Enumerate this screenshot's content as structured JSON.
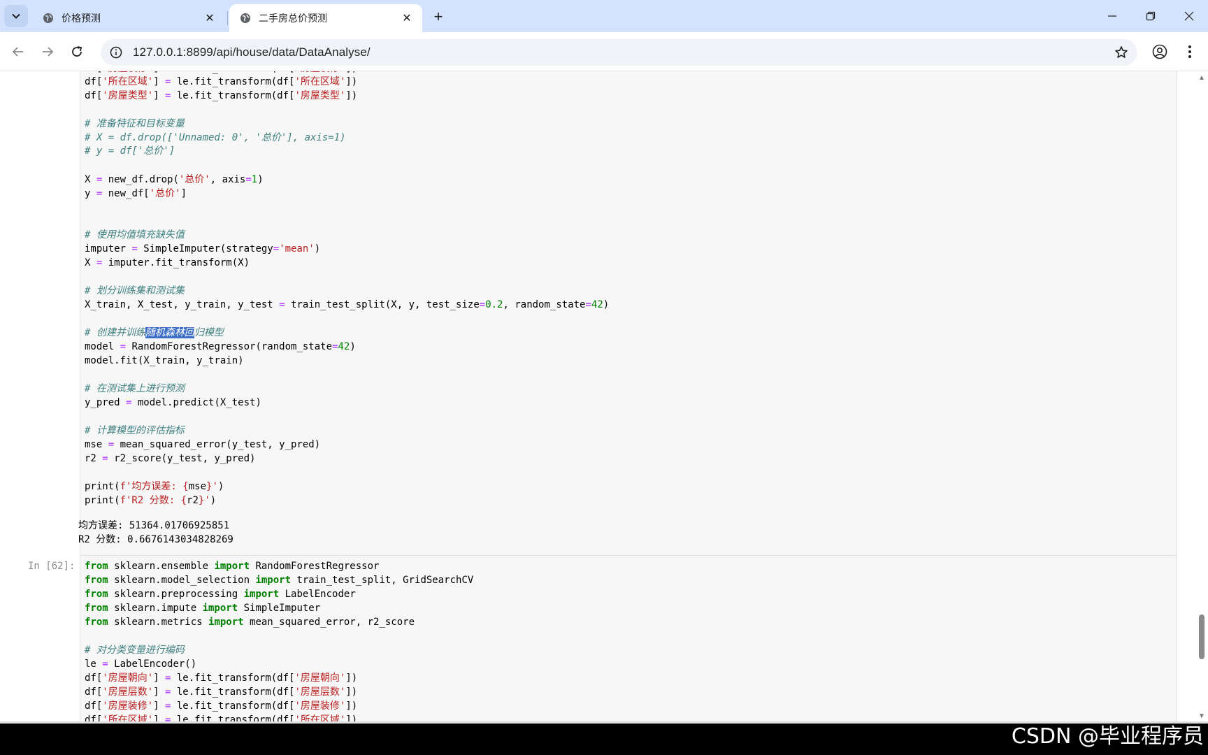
{
  "browser": {
    "tabs": [
      {
        "title": "价格预测",
        "active": false
      },
      {
        "title": "二手房总价预测",
        "active": true
      }
    ],
    "url": "127.0.0.1:8899/api/house/data/DataAnalyse/"
  },
  "cells": {
    "first": {
      "lines": [
        "df['所在区域'] = le.fit_transform(df['所在区域'])",
        "df['房屋类型'] = le.fit_transform(df['房屋类型'])",
        "",
        "# 准备特征和目标变量",
        "# X = df.drop(['Unnamed: 0', '总价'], axis=1)",
        "# y = df['总价']",
        "",
        "X = new_df.drop('总价', axis=1)",
        "y = new_df['总价']",
        "",
        "",
        "# 使用均值填充缺失值",
        "imputer = SimpleImputer(strategy='mean')",
        "X = imputer.fit_transform(X)",
        "",
        "# 划分训练集和测试集",
        "X_train, X_test, y_train, y_test = train_test_split(X, y, test_size=0.2, random_state=42)",
        "",
        "# 创建并训练随机森林回归模型",
        "model = RandomForestRegressor(random_state=42)",
        "model.fit(X_train, y_train)",
        "",
        "# 在测试集上进行预测",
        "y_pred = model.predict(X_test)",
        "",
        "# 计算模型的评估指标",
        "mse = mean_squared_error(y_test, y_pred)",
        "r2 = r2_score(y_test, y_pred)",
        "",
        "print(f'均方误差: {mse}')",
        "print(f'R2 分数: {r2}')"
      ],
      "output": [
        "均方误差: 51364.01706925851",
        "R2 分数: 0.6676143034828269"
      ]
    },
    "second": {
      "prompt": "In [62]:",
      "lines": [
        "from sklearn.ensemble import RandomForestRegressor",
        "from sklearn.model_selection import train_test_split, GridSearchCV",
        "from sklearn.preprocessing import LabelEncoder",
        "from sklearn.impute import SimpleImputer",
        "from sklearn.metrics import mean_squared_error, r2_score",
        "",
        "# 对分类变量进行编码",
        "le = LabelEncoder()",
        "df['房屋朝向'] = le.fit_transform(df['房屋朝向'])",
        "df['房屋层数'] = le.fit_transform(df['房屋层数'])",
        "df['房屋装修'] = le.fit_transform(df['房屋装修'])",
        "df['所在区域'] = le.fit_transform(df['所在区域'])"
      ]
    }
  },
  "selection_text": "随机森林回",
  "watermark": "CSDN @毕业程序员",
  "colors": {
    "keyword": "#008000",
    "comment": "#408080",
    "string": "#ba2121",
    "number": "#008000",
    "selection": "#3e6fc6",
    "tabbar": "#d3e3fd"
  }
}
